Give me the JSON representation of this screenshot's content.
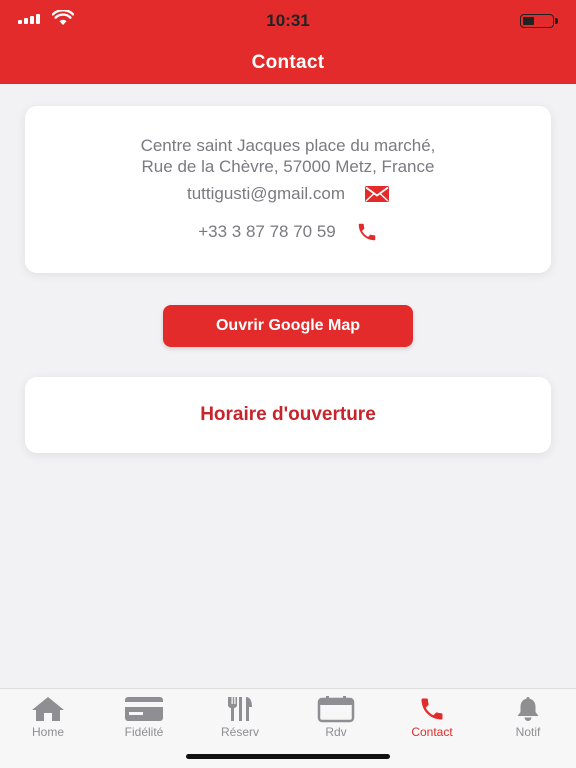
{
  "status_bar": {
    "time": "10:31"
  },
  "header": {
    "title": "Contact"
  },
  "address": {
    "line1": "Centre saint Jacques place du marché,",
    "line2": "Rue de la Chèvre, 57000 Metz, France"
  },
  "email": {
    "value": "tuttigusti@gmail.com",
    "icon": "mail-icon"
  },
  "phone": {
    "value": "+33 3 87 78 70 59",
    "icon": "phone-icon"
  },
  "map_button": {
    "label": "Ouvrir Google Map"
  },
  "hours": {
    "title": "Horaire d'ouverture"
  },
  "tabbar": {
    "items": [
      {
        "label": "Home",
        "icon": "home-icon"
      },
      {
        "label": "Fidélité",
        "icon": "card-icon"
      },
      {
        "label": "Réserv",
        "icon": "cutlery-icon"
      },
      {
        "label": "Rdv",
        "icon": "calendar-icon"
      },
      {
        "label": "Contact",
        "icon": "phone-icon",
        "active": true
      },
      {
        "label": "Notif",
        "icon": "bell-icon"
      }
    ]
  },
  "colors": {
    "accent": "#e32b2b",
    "accent_text": "#c8242b",
    "background": "#f2f2f4",
    "muted_text": "#7a7a80"
  }
}
